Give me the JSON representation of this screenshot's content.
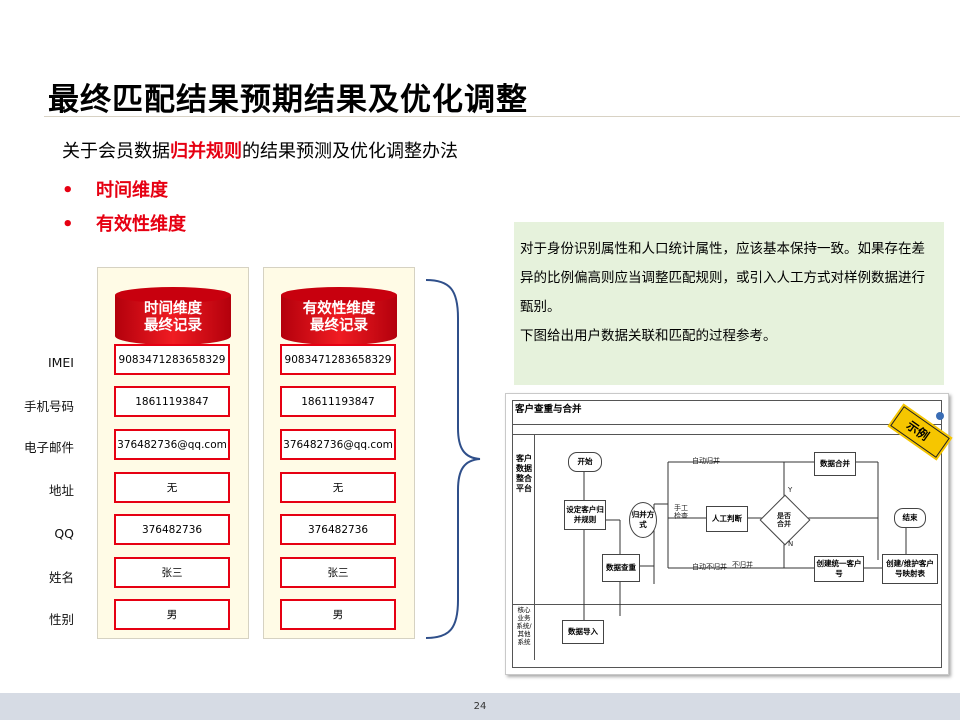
{
  "title": "最终匹配结果预期结果及优化调整",
  "intro": {
    "prefix": "关于会员数据",
    "highlight": "归并规则",
    "suffix": "的结果预测及优化调整办法"
  },
  "bullets": [
    "时间维度",
    "有效性维度"
  ],
  "bullet_marker": "•",
  "row_labels": [
    "IMEI",
    "手机号码",
    "电子邮件",
    "地址",
    "QQ",
    "姓名",
    "性别"
  ],
  "records": [
    {
      "header_line1": "时间维度",
      "header_line2": "最终记录",
      "values": [
        "9083471283658329",
        "18611193847",
        "376482736@qq.com",
        "无",
        "376482736",
        "张三",
        "男"
      ]
    },
    {
      "header_line1": "有效性维度",
      "header_line2": "最终记录",
      "values": [
        "9083471283658329",
        "18611193847",
        "376482736@qq.com",
        "无",
        "376482736",
        "张三",
        "男"
      ]
    }
  ],
  "note": {
    "p1": "对于身份识别属性和人口统计属性，应该基本保持一致。如果存在差异的比例偏高则应当调整匹配规则，或引入人工方式对样例数据进行甄别。",
    "p2": "下图给出用户数据关联和匹配的过程参考。"
  },
  "diagram": {
    "header": "客户查重与合并",
    "badge": "示例",
    "lane1": "客户数据整合平台",
    "lane2": "核心业务系统/其他系统",
    "nodes": {
      "start": "开始",
      "set_rules": "设定客户归并规则",
      "merge_mode": "归并方式",
      "manual_judge": "人工判断",
      "merge_decision": "是否合并",
      "data_merge": "数据合并",
      "create_id": "创建统一客户号",
      "end": "结束",
      "build_map": "创建/维护客户号映射表",
      "data_check": "数据查重",
      "data_import": "数据导入"
    },
    "edges": {
      "auto_merge": "自动归并",
      "manual_check": "手工检查",
      "auto_no_merge": "自动不归并",
      "no_merge": "不归并",
      "yes": "Y",
      "no": "N"
    }
  },
  "page_number": "24",
  "colors": {
    "accent": "#e60012",
    "note_bg": "#e6f2dc",
    "panel_bg": "#fffbe6",
    "footer": "#d6dbe4"
  }
}
